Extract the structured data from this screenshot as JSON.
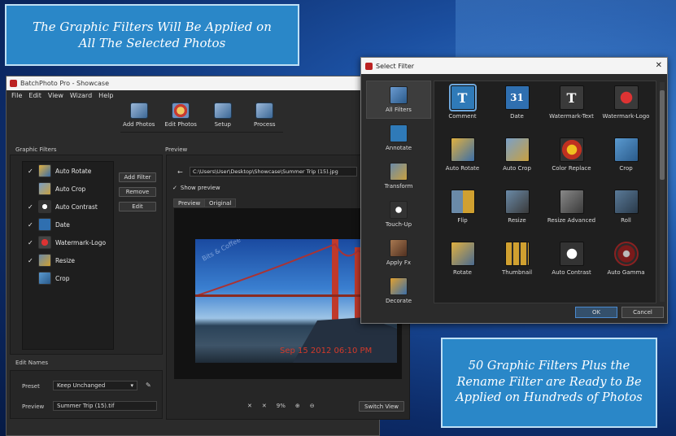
{
  "callouts": {
    "top": "The Graphic Filters Will Be Applied on All The Selected Photos",
    "bottom": "50 Graphic Filters Plus the Rename Filter are Ready to Be Applied on Hundreds of Photos"
  },
  "app": {
    "title": "BatchPhoto Pro - Showcase",
    "menu": [
      "File",
      "Edit",
      "View",
      "Wizard",
      "Help"
    ],
    "toolbar": [
      "Add Photos",
      "Edit Photos",
      "Setup",
      "Process"
    ],
    "graphic_filters_label": "Graphic Filters",
    "filters": [
      {
        "name": "Auto Rotate",
        "checked": true,
        "icon": "auto-rotate-icon"
      },
      {
        "name": "Auto Crop",
        "checked": false,
        "icon": "auto-crop-icon"
      },
      {
        "name": "Auto Contrast",
        "checked": true,
        "icon": "auto-contrast-icon"
      },
      {
        "name": "Date",
        "checked": true,
        "icon": "date-icon"
      },
      {
        "name": "Watermark-Logo",
        "checked": true,
        "icon": "watermark-logo-icon"
      },
      {
        "name": "Resize",
        "checked": true,
        "icon": "resize-icon"
      },
      {
        "name": "Crop",
        "checked": false,
        "icon": "crop-icon"
      }
    ],
    "filter_buttons": {
      "add": "Add Filter",
      "remove": "Remove",
      "edit": "Edit"
    },
    "preview_label": "Preview",
    "path": "C:\\Users\\User\\Desktop\\Showcase\\Summer Trip (15).jpg",
    "show_preview": "Show preview",
    "tabs": [
      "Preview",
      "Original"
    ],
    "watermark": "Bits & Coffee",
    "date_stamp": "Sep 15 2012 06:10 PM",
    "zoom": "9%",
    "switch_view": "Switch View",
    "edit_names_label": "Edit Names",
    "preset_label": "Preset",
    "preset_value": "Keep Unchanged",
    "preview_name_label": "Preview",
    "preview_name_value": "Summer Trip (15).tif"
  },
  "dialog": {
    "title": "Select Filter",
    "categories": [
      "All Filters",
      "Annotate",
      "Transform",
      "Touch-Up",
      "Apply Fx",
      "Decorate"
    ],
    "filters": [
      "Comment",
      "Date",
      "Watermark-Text",
      "Watermark-Logo",
      "Auto Rotate",
      "Auto Crop",
      "Color Replace",
      "Crop",
      "Flip",
      "Resize",
      "Resize Advanced",
      "Roll",
      "Rotate",
      "Thumbnail",
      "Auto Contrast",
      "Auto Gamma"
    ],
    "ok": "OK",
    "cancel": "Cancel"
  }
}
